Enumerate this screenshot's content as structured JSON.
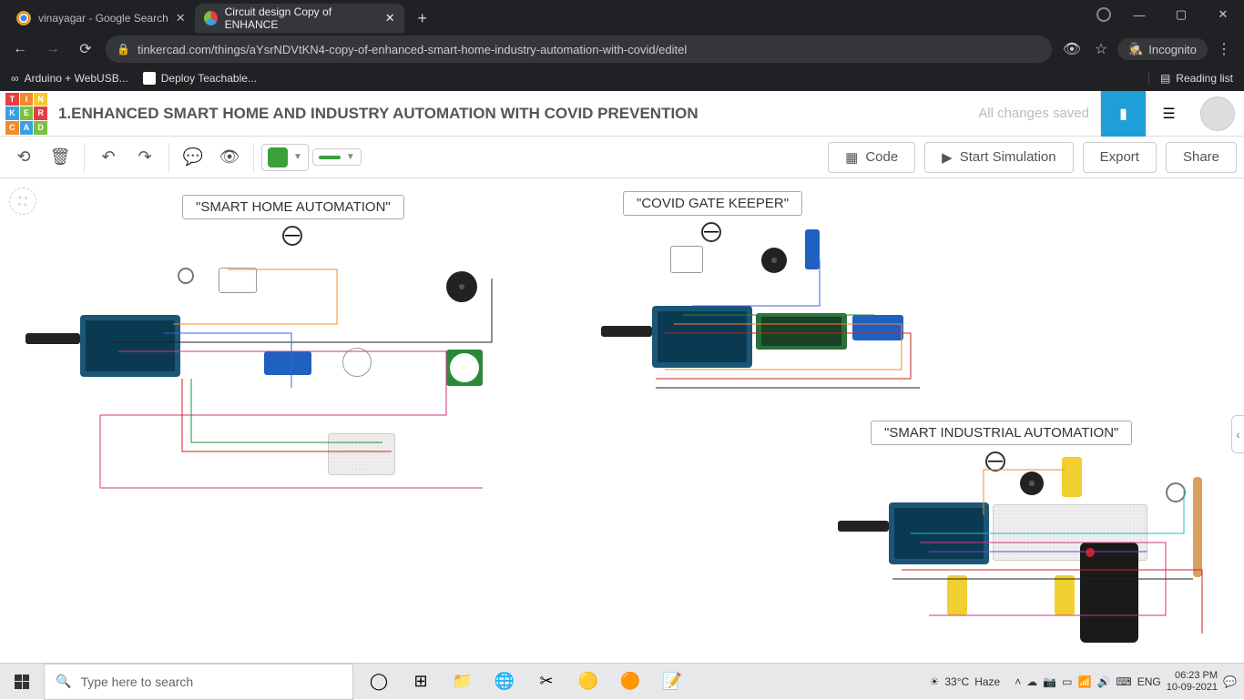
{
  "browser": {
    "tabs": [
      {
        "title": "vinayagar - Google Search",
        "active": false
      },
      {
        "title": "Circuit design Copy of ENHANCE",
        "active": true
      }
    ],
    "url": "tinkercad.com/things/aYsrNDVtKN4-copy-of-enhanced-smart-home-industry-automation-with-covid/editel",
    "incognito_label": "Incognito",
    "bookmarks": [
      {
        "label": "Arduino + WebUSB..."
      },
      {
        "label": "Deploy Teachable..."
      }
    ],
    "reading_list": "Reading list"
  },
  "tinkercad": {
    "logo_letters": [
      "T",
      "I",
      "N",
      "K",
      "E",
      "R",
      "C",
      "A",
      "D"
    ],
    "logo_colors": [
      "#e83e3e",
      "#f08b2e",
      "#f5c92e",
      "#3aa0e0",
      "#7ac043",
      "#e83e3e",
      "#f08b2e",
      "#3aa0e0",
      "#7ac043"
    ],
    "title": "1.ENHANCED SMART HOME AND INDUSTRY AUTOMATION WITH COVID PREVENTION",
    "status": "All changes saved",
    "buttons": {
      "code": "Code",
      "start_sim": "Start Simulation",
      "export": "Export",
      "share": "Share"
    },
    "color_swatch": "#3aa03a"
  },
  "circuits": {
    "a": {
      "title": "\"SMART HOME AUTOMATION\""
    },
    "b": {
      "title": "\"COVID GATE KEEPER\""
    },
    "c": {
      "title": "\"SMART INDUSTRIAL AUTOMATION\""
    }
  },
  "taskbar": {
    "search_placeholder": "Type here to search",
    "weather_temp": "33°C",
    "weather_cond": "Haze",
    "lang": "ENG",
    "time": "06:23 PM",
    "date": "10-09-2021"
  }
}
